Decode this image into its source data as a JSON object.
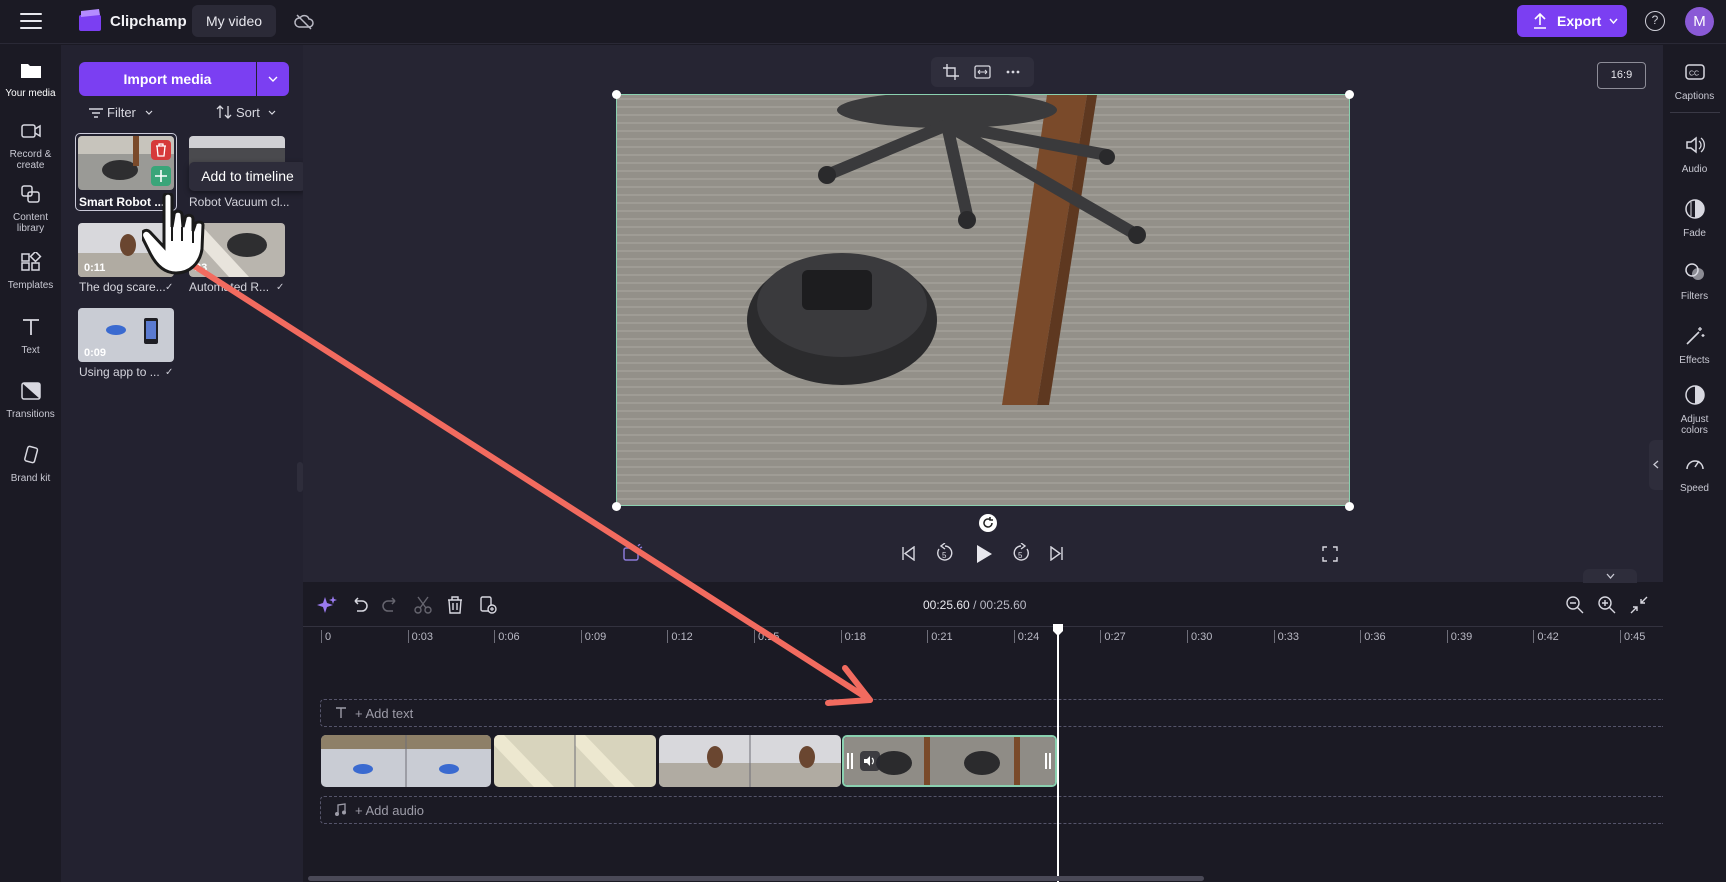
{
  "app": {
    "name": "Clipchamp",
    "video_title": "My video",
    "avatar_initial": "M",
    "export_label": "Export",
    "help_glyph": "?"
  },
  "left_rail": [
    {
      "label": "Your media",
      "icon": "folder-icon"
    },
    {
      "label": "Record &\ncreate",
      "icon": "camera-icon"
    },
    {
      "label": "Content\nlibrary",
      "icon": "content-library-icon"
    },
    {
      "label": "Templates",
      "icon": "templates-icon"
    },
    {
      "label": "Text",
      "icon": "text-icon"
    },
    {
      "label": "Transitions",
      "icon": "transitions-icon"
    },
    {
      "label": "Brand kit",
      "icon": "brand-kit-icon"
    }
  ],
  "media_panel": {
    "import_label": "Import media",
    "filter_label": "Filter",
    "sort_label": "Sort",
    "items": [
      {
        "caption": "Smart Robot ...",
        "duration": "",
        "checked": false
      },
      {
        "caption": "Robot Vacuum cl...",
        "duration": "",
        "checked": false
      },
      {
        "caption": "The dog scare...",
        "duration": "0:11",
        "checked": true
      },
      {
        "caption": "Automated R...",
        "duration": "23",
        "checked": true
      },
      {
        "caption": "Using app to ...",
        "duration": "0:09",
        "checked": true
      }
    ],
    "tooltip": "Add to timeline"
  },
  "preview": {
    "aspect_ratio": "16:9"
  },
  "right_rail": [
    {
      "label": "Captions",
      "icon": "captions-icon"
    },
    {
      "label": "Audio",
      "icon": "speaker-icon"
    },
    {
      "label": "Fade",
      "icon": "fade-icon"
    },
    {
      "label": "Filters",
      "icon": "filters-icon"
    },
    {
      "label": "Effects",
      "icon": "effects-icon"
    },
    {
      "label": "Adjust\ncolors",
      "icon": "adjust-colors-icon"
    },
    {
      "label": "Speed",
      "icon": "speed-icon"
    }
  ],
  "timeline": {
    "current_time": "00:25.60",
    "total_time": "/ 00:25.60",
    "ruler": [
      "0",
      "0:03",
      "0:06",
      "0:09",
      "0:12",
      "0:15",
      "0:18",
      "0:21",
      "0:24",
      "0:27",
      "0:30",
      "0:33",
      "0:36",
      "0:39",
      "0:42",
      "0:45"
    ],
    "add_text_label": "+ Add text",
    "add_audio_label": "+ Add audio"
  },
  "colors": {
    "accent": "#7b3ff2",
    "selection": "#8ad1b0",
    "annotation_arrow": "#f26b5f",
    "danger": "#d63a3a",
    "add": "#3aa579"
  }
}
